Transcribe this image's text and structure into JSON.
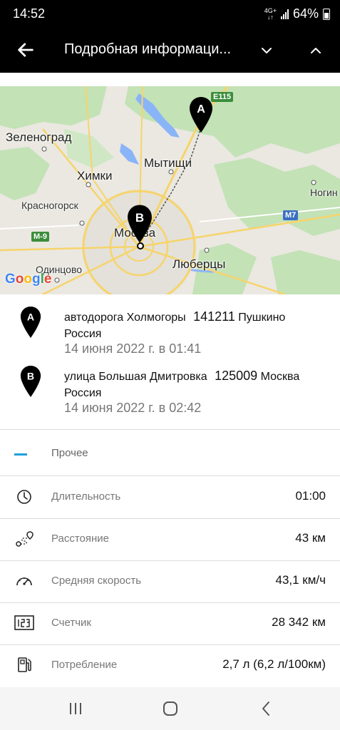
{
  "status_bar": {
    "time": "14:52",
    "network": "4G+",
    "battery": "64%"
  },
  "app_bar": {
    "back_icon": "arrow-left-icon",
    "title": "Подробная информаци...",
    "down_icon": "chevron-down-icon",
    "up_icon": "chevron-up-icon"
  },
  "map": {
    "labels": {
      "zelenograd": "Зеленоград",
      "khimki": "Химки",
      "mytishchi": "Мытищи",
      "krasnogorsk": "Красногорск",
      "moscow": "Москва",
      "odintsovo": "Одинцово",
      "lyubertsy": "Люберцы",
      "noginsk": "Ногин"
    },
    "road_shields": {
      "e115": "E115",
      "m7": "M7",
      "m9": "M-9"
    },
    "markers": {
      "a": "A",
      "b": "B"
    },
    "attribution": "Google",
    "colors": {
      "water": "#8ab4f8",
      "green": "#bfe0b3",
      "land": "#eae8e1",
      "road": "#f7d46a"
    }
  },
  "route": {
    "start": {
      "marker": "A",
      "street": "автодорога Холмогоры",
      "zip": "141211",
      "city": "Пушкино",
      "country": "Россия",
      "time": "14 июня 2022 г. в 01:41"
    },
    "end": {
      "marker": "B",
      "street": "улица Большая Дмитровка",
      "zip": "125009",
      "city": "Москва",
      "country": "Россия",
      "time": "14 июня 2022 г. в 02:42"
    }
  },
  "category": {
    "label": "Прочее",
    "color": "#1ea0dc"
  },
  "details": [
    {
      "icon": "clock-icon",
      "label": "Длительность",
      "value": "01:00"
    },
    {
      "icon": "route-distance-icon",
      "label": "Расстояние",
      "value": "43 км"
    },
    {
      "icon": "speedometer-icon",
      "label": "Средняя скорость",
      "value": "43,1 км/ч"
    },
    {
      "icon": "odometer-icon",
      "label": "Счетчик",
      "value": "28 342 км"
    },
    {
      "icon": "fuel-pump-icon",
      "label": "Потребление",
      "value": "2,7 л (6,2 л/100км)"
    }
  ],
  "nav_bar": {
    "recents_icon": "recents-icon",
    "home_icon": "home-icon",
    "back_icon": "back-icon"
  }
}
